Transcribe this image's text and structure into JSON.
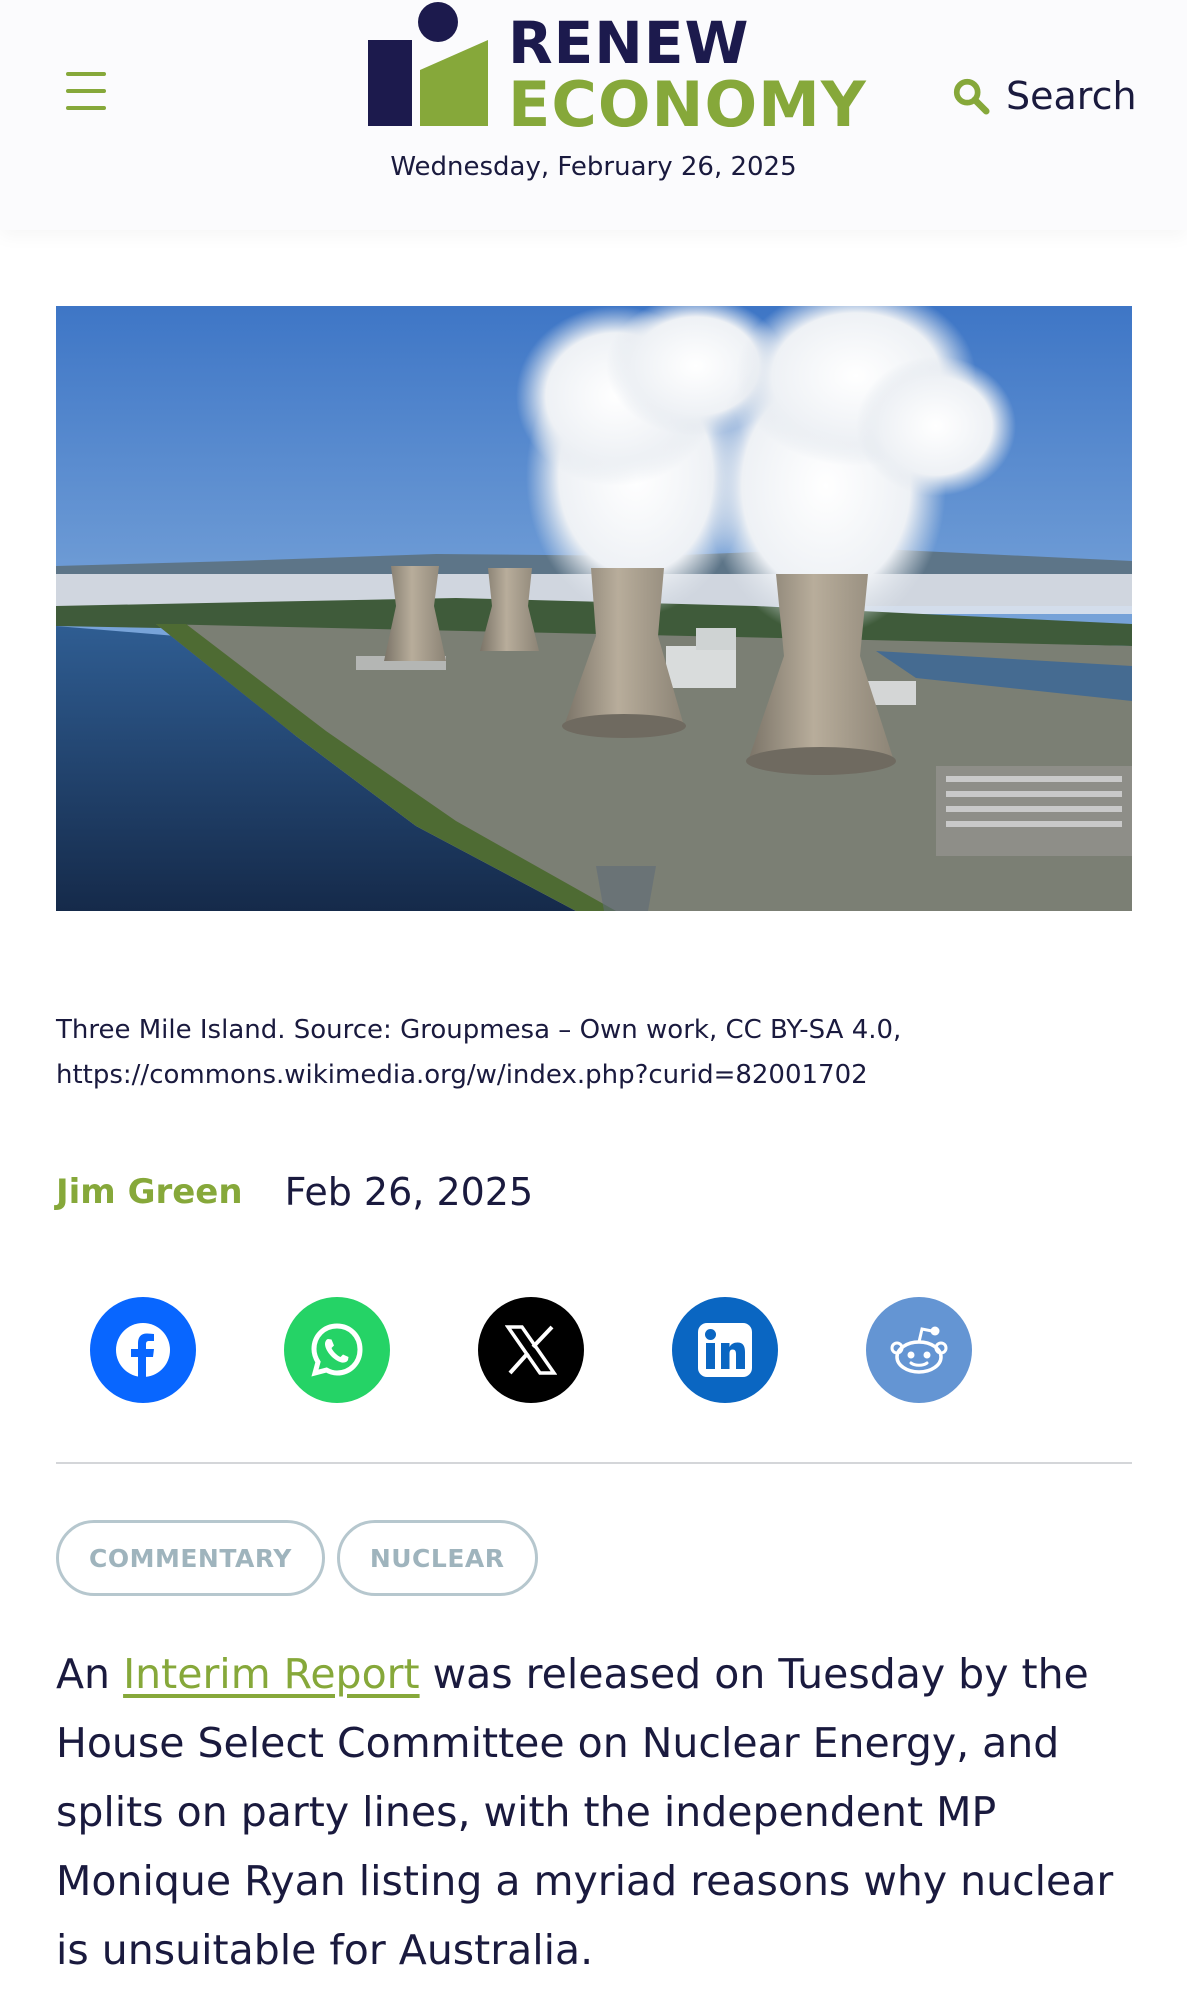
{
  "header": {
    "logo": {
      "line1": "RENEW",
      "line2": "ECONOMY",
      "colors": {
        "navy": "#1c1a4d",
        "green": "#86a83a"
      }
    },
    "date": "Wednesday, February 26, 2025",
    "search_label": "Search",
    "menu_icon": "hamburger-menu-icon",
    "search_icon": "search-icon"
  },
  "hero_image": {
    "subject": "cooling towers with steam plumes beside a river"
  },
  "caption": {
    "line1": "Three Mile Island. Source: Groupmesa – Own work, CC BY-SA 4.0,",
    "line2": "https://commons.wikimedia.org/w/index.php?curid=82001702"
  },
  "byline": {
    "author": "Jim Green",
    "date": "Feb 26, 2025"
  },
  "share": [
    {
      "icon": "facebook-icon",
      "color": "#0866ff"
    },
    {
      "icon": "whatsapp-icon",
      "color": "#25d366"
    },
    {
      "icon": "x-icon",
      "color": "#000000"
    },
    {
      "icon": "linkedin-icon",
      "color": "#0a66c2"
    },
    {
      "icon": "reddit-icon",
      "color": "#6495d3"
    }
  ],
  "tags": [
    "COMMENTARY",
    "NUCLEAR"
  ],
  "article": {
    "prefix": "An ",
    "link_text": "Interim Report",
    "rest": " was released on Tuesday by the House Select Committee on Nuclear Energy, and splits on party lines, with the independent MP Monique Ryan listing a myriad reasons why nuclear is unsuitable for Australia."
  }
}
